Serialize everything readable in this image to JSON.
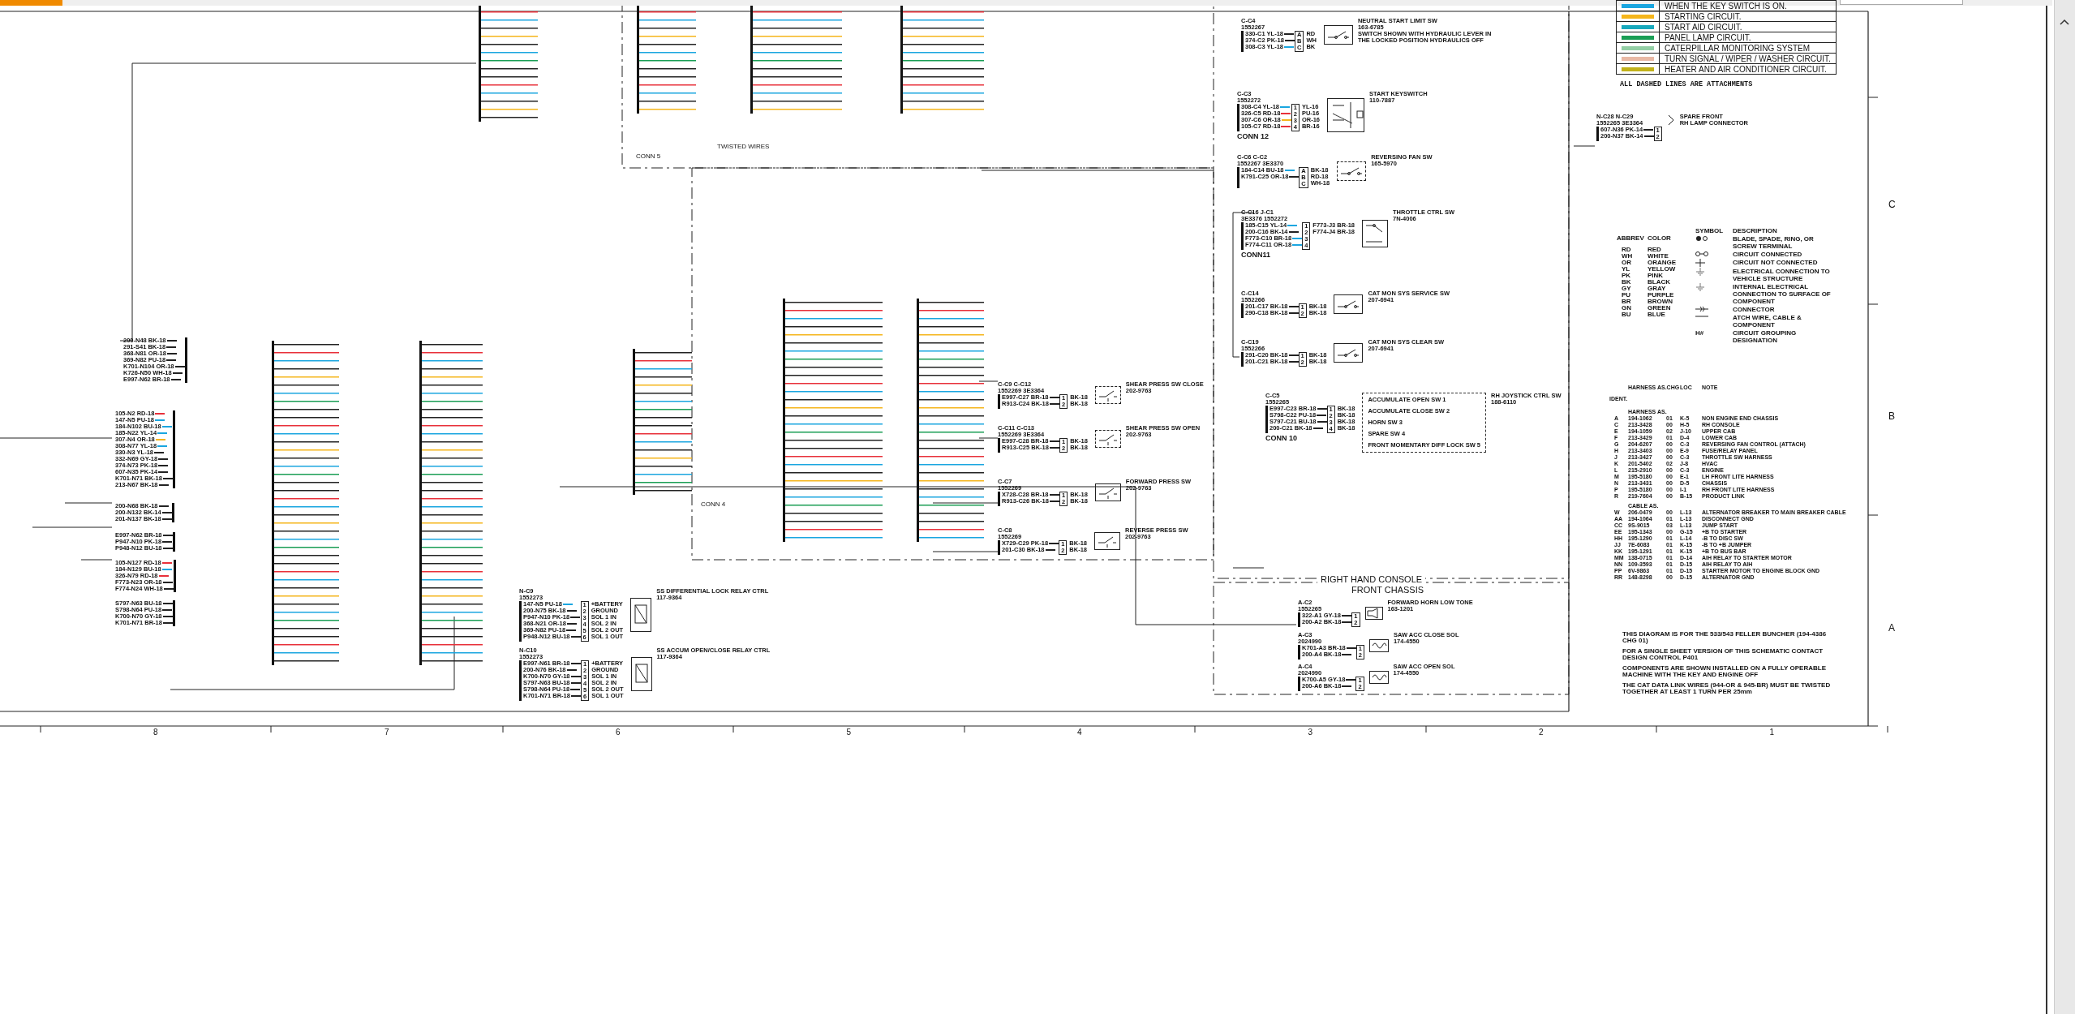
{
  "legend": {
    "rows": [
      {
        "color": "#1aa6e0",
        "label": "WHEN THE KEY SWITCH IS ON."
      },
      {
        "color": "#f5b51b",
        "label": "STARTING CIRCUIT."
      },
      {
        "color": "#17a9bd",
        "label": "START AID CIRCUIT."
      },
      {
        "color": "#1a9e55",
        "label": "PANEL LAMP CIRCUIT."
      },
      {
        "color": "#93cfa5",
        "label": "CATERPILLAR MONITORING SYSTEM"
      },
      {
        "color": "#e9b9a5",
        "label": "TURN SIGNAL / WIPER / WASHER CIRCUIT."
      },
      {
        "color": "#c2b21a",
        "label": "HEATER AND AIR CONDITIONER CIRCUIT."
      }
    ],
    "footnote": "ALL DASHED LINES ARE ATTACHMENTS"
  },
  "abbreviations": {
    "headers": [
      "ABBREV",
      "COLOR"
    ],
    "rows": [
      {
        "abbrev": "RD",
        "color_name": "RED"
      },
      {
        "abbrev": "WH",
        "color_name": "WHITE"
      },
      {
        "abbrev": "OR",
        "color_name": "ORANGE"
      },
      {
        "abbrev": "YL",
        "color_name": "YELLOW"
      },
      {
        "abbrev": "PK",
        "color_name": "PINK"
      },
      {
        "abbrev": "BK",
        "color_name": "BLACK"
      },
      {
        "abbrev": "GY",
        "color_name": "GRAY"
      },
      {
        "abbrev": "PU",
        "color_name": "PURPLE"
      },
      {
        "abbrev": "BR",
        "color_name": "BROWN"
      },
      {
        "abbrev": "GN",
        "color_name": "GREEN"
      },
      {
        "abbrev": "BU",
        "color_name": "BLUE"
      }
    ]
  },
  "symbols": {
    "headers": [
      "SYMBOL",
      "DESCRIPTION"
    ],
    "rows": [
      {
        "kind": "terminal",
        "description": "BLADE, SPADE, RING, OR SCREW TERMINAL"
      },
      {
        "kind": "connected",
        "description": "CIRCUIT CONNECTED"
      },
      {
        "kind": "not-connected",
        "description": "CIRCUIT NOT CONNECTED"
      },
      {
        "kind": "ground",
        "description": "ELECTRICAL CONNECTION TO VEHICLE STRUCTURE"
      },
      {
        "kind": "internal-ground",
        "description": "INTERNAL ELECTRICAL CONNECTION TO SURFACE OF COMPONENT"
      },
      {
        "kind": "connector",
        "description": "CONNECTOR"
      },
      {
        "kind": "attach-line",
        "description": "ATCH WIRE, CABLE & COMPONENT"
      },
      {
        "kind": "grouping",
        "symbol": "H#",
        "description": "CIRCUIT GROUPING DESIGNATION"
      }
    ]
  },
  "harness_table": {
    "headers": [
      "HARNESS AS.CHG",
      "LOC",
      "NOTE"
    ],
    "ident": "IDENT.",
    "groups": [
      {
        "title": "HARNESS AS.",
        "rows": [
          [
            "A",
            "194-1062",
            "01",
            "K-5",
            "NON ENGINE END CHASSIS"
          ],
          [
            "C",
            "213-3428",
            "00",
            "H-5",
            "RH CONSOLE"
          ],
          [
            "E",
            "194-1059",
            "02",
            "J-10",
            "UPPER CAB"
          ],
          [
            "F",
            "213-3429",
            "01",
            "D-4",
            "LOWER CAB"
          ],
          [
            "G",
            "204-6207",
            "00",
            "C-3",
            "REVERSING FAN CONTROL (ATTACH)"
          ],
          [
            "H",
            "213-3403",
            "00",
            "E-9",
            "FUSE/RELAY PANEL"
          ],
          [
            "J",
            "213-3427",
            "00",
            "C-3",
            "THROTTLE SW HARNESS"
          ],
          [
            "K",
            "201-5402",
            "02",
            "J-8",
            "HVAC"
          ],
          [
            "L",
            "215-2910",
            "00",
            "C-3",
            "ENGINE"
          ],
          [
            "M",
            "195-5180",
            "00",
            "E-1",
            "LH FRONT LITE HARNESS"
          ],
          [
            "N",
            "213-3431",
            "00",
            "D-5",
            "CHASSIS"
          ],
          [
            "P",
            "195-5180",
            "00",
            "I-1",
            "RH FRONT LITE HARNESS"
          ],
          [
            "R",
            "219-7604",
            "00",
            "B-15",
            "PRODUCT LINK"
          ]
        ]
      },
      {
        "title": "CABLE AS.",
        "rows": [
          [
            "W",
            "206-0479",
            "00",
            "L-13",
            "ALTERNATOR BREAKER TO MAIN BREAKER CABLE"
          ],
          [
            "AA",
            "194-1064",
            "01",
            "L-13",
            "DISCONNECT GND"
          ],
          [
            "CC",
            "9S-9015",
            "03",
            "L-13",
            "JUMP START"
          ],
          [
            "EE",
            "195-1343",
            "00",
            "G-15",
            "+B TO STARTER"
          ],
          [
            "HH",
            "195-1290",
            "01",
            "L-14",
            "-B TO DISC SW"
          ],
          [
            "JJ",
            "7E-6083",
            "01",
            "K-15",
            "-B TO +B JUMPER"
          ],
          [
            "KK",
            "195-1291",
            "01",
            "K-15",
            "+B TO BUS BAR"
          ],
          [
            "MM",
            "138-0715",
            "01",
            "D-14",
            "AIH RELAY TO STARTER MOTOR"
          ],
          [
            "NN",
            "109-3593",
            "01",
            "D-15",
            "AIH RELAY TO AIH"
          ],
          [
            "PP",
            "6V-9863",
            "01",
            "D-15",
            "STARTER MOTOR TO ENGINE BLOCK GND"
          ],
          [
            "RR",
            "148-8298",
            "00",
            "D-15",
            "ALTERNATOR GND"
          ]
        ]
      }
    ]
  },
  "notes": [
    "THIS DIAGRAM IS FOR THE 533/543 FELLER BUNCHER (194-4386 CHG 01)",
    "FOR A SINGLE SHEET VERSION OF THIS SCHEMATIC CONTACT DESIGN CONTROL P401",
    "COMPONENTS ARE SHOWN INSTALLED ON A FULLY OPERABLE MACHINE WITH THE KEY AND ENGINE OFF",
    "THE CAT DATA LINK WIRES (944-OR & 945-BR) MUST BE TWISTED TOGETHER AT LEAST 1 TURN PER 25mm"
  ],
  "grid": {
    "columns": [
      "8",
      "7",
      "6",
      "5",
      "4",
      "3",
      "2",
      "1"
    ],
    "rows": [
      "C",
      "B",
      "A"
    ]
  },
  "areas": [
    {
      "kind": "console",
      "title": "RIGHT HAND CONSOLE"
    },
    {
      "kind": "chassis",
      "title": "FRONT CHASSIS"
    },
    {
      "kind": "label",
      "title": "CONN 5"
    },
    {
      "kind": "label",
      "title": "CONN 4"
    },
    {
      "kind": "label",
      "title": "TWISTED WIRES"
    }
  ],
  "devices": [
    {
      "kind": "switch",
      "attachment": false,
      "title": [
        "NEUTRAL START LIMIT SW",
        "163-6785"
      ],
      "connector": [
        "C-C4",
        "1552267"
      ],
      "wires": [
        {
          "label": "330-C1 YL-18"
        },
        {
          "label": "374-C2 PK-18"
        },
        {
          "label": "308-C3 YL-18",
          "color": "#1aa6e0"
        }
      ],
      "pins": [
        "A",
        "B",
        "C"
      ],
      "outputs": [
        "RD",
        "WH",
        "BK"
      ],
      "note": "SWITCH SHOWN WITH HYDRAULIC LEVER IN THE LOCKED POSITION HYDRAULICS OFF"
    },
    {
      "kind": "keyswitch",
      "attachment": false,
      "title": [
        "START KEYSWITCH",
        "110-7887"
      ],
      "connector": [
        "C-C3",
        "1552272"
      ],
      "wires": [
        {
          "label": "308-C4 YL-18",
          "color": "#1aa6e0"
        },
        {
          "label": "326-C5 RD-18",
          "color": "#e8303a"
        },
        {
          "label": "307-C6 OR-18",
          "color": "#f5b51b"
        },
        {
          "label": "105-C7 RD-18",
          "color": "#e8303a"
        }
      ],
      "pins": [
        "1",
        "2",
        "3",
        "4"
      ],
      "outputs": [
        "YL-16",
        "PU-16",
        "OR-16",
        "BR-16"
      ],
      "footer": "CONN 12"
    },
    {
      "kind": "switch",
      "attachment": true,
      "title": [
        "REVERSING FAN SW",
        "165-5970"
      ],
      "connector": [
        "C-C6 C-C2",
        "1552267 3E3370"
      ],
      "wires": [
        {
          "label": "184-C14 BU-18",
          "color": "#1aa6e0"
        },
        {
          "label": "K791-C25 OR-18"
        }
      ],
      "pins": [
        "A",
        "B",
        "C"
      ],
      "outputs": [
        "BK-18",
        "RD-18",
        "WH-18"
      ]
    },
    {
      "kind": "throttle",
      "attachment": false,
      "title": [
        "THROTTLE CTRL SW",
        "7N-4006"
      ],
      "connector": [
        "C-C16 J-C1",
        "3E3376 1552272"
      ],
      "wires": [
        {
          "label": "185-C15 YL-14",
          "color": "#1aa6e0"
        },
        {
          "label": "200-C16 BK-14"
        },
        {
          "label": "F773-C10 BR-18",
          "color": "#1aa6e0"
        },
        {
          "label": "F774-C11 OR-18",
          "color": "#1aa6e0"
        }
      ],
      "pins": [
        "1",
        "2",
        "3",
        "4"
      ],
      "outputs": [
        "F773-J3 BR-18",
        "F774-J4 BR-18"
      ],
      "footer": "CONN11"
    },
    {
      "kind": "switch",
      "attachment": false,
      "title": [
        "CAT MON SYS SERVICE SW",
        "207-6941"
      ],
      "connector": [
        "C-C14",
        "1552266"
      ],
      "wires": [
        {
          "label": "201-C17 BK-18"
        },
        {
          "label": "290-C18 BK-18"
        }
      ],
      "pins": [
        "1",
        "2"
      ],
      "outputs": [
        "BK-18",
        "BK-18"
      ]
    },
    {
      "kind": "switch",
      "attachment": false,
      "title": [
        "CAT MON SYS CLEAR SW",
        "207-6941"
      ],
      "connector": [
        "C-C19",
        "1552266"
      ],
      "wires": [
        {
          "label": "291-C20 BK-18"
        },
        {
          "label": "201-C21 BK-18"
        }
      ],
      "pins": [
        "1",
        "2"
      ],
      "outputs": [
        "BK-18",
        "BK-18"
      ]
    },
    {
      "kind": "joystick",
      "attachment": true,
      "title": [
        "RH JOYSTICK CTRL SW",
        "188-6110"
      ],
      "connector": [
        "C-C5",
        "1552265"
      ],
      "wires": [
        {
          "label": "E997-C23 BR-18"
        },
        {
          "label": "S798-C22 PU-18"
        },
        {
          "label": "S797-C21 BU-18"
        },
        {
          "label": "200-C21 BK-18"
        }
      ],
      "pins": [
        "1",
        "2",
        "3",
        "4"
      ],
      "outputs": [
        "BK-18",
        "BK-18",
        "BK-18",
        "BK-18"
      ],
      "switches": [
        "ACCUMULATE OPEN SW 1",
        "ACCUMULATE CLOSE SW 2",
        "HORN SW 3",
        "SPARE SW 4",
        "FRONT MOMENTARY DIFF LOCK SW 5"
      ],
      "footer": "CONN 10"
    },
    {
      "kind": "pressure",
      "attachment": true,
      "title": [
        "SHEAR PRESS SW CLOSE",
        "202-9763"
      ],
      "connector": [
        "C-C9 C-C12",
        "1552269 3E3364"
      ],
      "wires": [
        {
          "label": "E997-C27 BR-18"
        },
        {
          "label": "R913-C24 BK-18"
        }
      ],
      "pins": [
        "1",
        "2"
      ],
      "outputs": [
        "BK-18",
        "BK-18"
      ]
    },
    {
      "kind": "pressure",
      "attachment": true,
      "title": [
        "SHEAR PRESS SW OPEN",
        "202-9763"
      ],
      "connector": [
        "C-C11 C-C13",
        "1552269 3E3364"
      ],
      "wires": [
        {
          "label": "E997-C28 BR-18"
        },
        {
          "label": "R913-C25 BK-18"
        }
      ],
      "pins": [
        "1",
        "2"
      ],
      "outputs": [
        "BK-18",
        "BK-18"
      ]
    },
    {
      "kind": "pressure",
      "attachment": false,
      "title": [
        "FORWARD PRESS SW",
        "202-9763"
      ],
      "connector": [
        "C-C7",
        "1552269"
      ],
      "wires": [
        {
          "label": "X728-C28 BR-18"
        },
        {
          "label": "R913-C26 BK-18"
        }
      ],
      "pins": [
        "1",
        "2"
      ],
      "outputs": [
        "BK-18",
        "BK-18"
      ]
    },
    {
      "kind": "pressure",
      "attachment": false,
      "title": [
        "REVERSE PRESS SW",
        "202-9763"
      ],
      "connector": [
        "C-C8",
        "1552269"
      ],
      "wires": [
        {
          "label": "X729-C29 PK-18"
        },
        {
          "label": "201-C30 BK-18"
        }
      ],
      "pins": [
        "1",
        "2"
      ],
      "outputs": [
        "BK-18",
        "BK-18"
      ]
    },
    {
      "kind": "horn",
      "title": [
        "FORWARD HORN LOW TONE",
        "163-1201"
      ],
      "connector": [
        "A-C2",
        "1552265"
      ],
      "wires": [
        {
          "label": "322-A1 GY-18"
        },
        {
          "label": "200-A2 BK-18"
        }
      ],
      "pins": [
        "1",
        "2"
      ]
    },
    {
      "kind": "solenoid",
      "title": [
        "SAW ACC CLOSE SOL",
        "174-4550"
      ],
      "connector": [
        "A-C3",
        "2024990"
      ],
      "wires": [
        {
          "label": "K701-A3 BR-18"
        },
        {
          "label": "200-A4 BK-18"
        }
      ],
      "pins": [
        "1",
        "2"
      ]
    },
    {
      "kind": "solenoid",
      "title": [
        "SAW ACC OPEN SOL",
        "174-4550"
      ],
      "connector": [
        "A-C4",
        "2024990"
      ],
      "wires": [
        {
          "label": "K700-A5 GY-18"
        },
        {
          "label": "200-A6 BK-18"
        }
      ],
      "pins": [
        "1",
        "2"
      ]
    },
    {
      "kind": "lamp",
      "title": [
        "SPARE FRONT",
        "RH LAMP CONNECTOR"
      ],
      "connector": [
        "N-C28 N-C29",
        "1552265 3E3364"
      ],
      "wires": [
        {
          "label": "607-N36 PK-14"
        },
        {
          "label": "200-N37 BK-14"
        }
      ],
      "pins": [
        "1",
        "2"
      ]
    },
    {
      "kind": "relay",
      "title": [
        "SS DIFFERENTIAL LOCK RELAY CTRL",
        "117-9364"
      ],
      "connector": [
        "N-C9",
        "1552273"
      ],
      "wires": [
        {
          "label": "147-N5 PU-18",
          "color": "#1aa6e0"
        },
        {
          "label": "200-N75 BK-18"
        },
        {
          "label": "P947-N10 PK-18"
        },
        {
          "label": "368-N21 OR-18"
        },
        {
          "label": "369-N82 PU-18"
        },
        {
          "label": "P948-N12 BU-18"
        }
      ],
      "pins": [
        "1",
        "2",
        "3",
        "4",
        "5",
        "6"
      ],
      "outputs": [
        "+BATTERY",
        "GROUND",
        "SOL 1 IN",
        "SOL 2 IN",
        "SOL 2 OUT",
        "SOL 1 OUT"
      ]
    },
    {
      "kind": "relay",
      "title": [
        "SS ACCUM OPEN/CLOSE RELAY CTRL",
        "117-9364"
      ],
      "connector": [
        "N-C10",
        "1552273"
      ],
      "wires": [
        {
          "label": "E997-N61 BR-18"
        },
        {
          "label": "200-N76 BK-18"
        },
        {
          "label": "K700-N70 GY-18"
        },
        {
          "label": "S797-N63 BU-18"
        },
        {
          "label": "S798-N64 PU-18"
        },
        {
          "label": "K701-N71 BR-18"
        }
      ],
      "pins": [
        "1",
        "2",
        "3",
        "4",
        "5",
        "6"
      ],
      "outputs": [
        "+BATTERY",
        "GROUND",
        "SOL 1 IN",
        "SOL 2 IN",
        "SOL 2 OUT",
        "SOL 1 OUT"
      ]
    }
  ],
  "bundles": [
    {
      "wires": [
        {
          "label": "200-N48 BK-18"
        },
        {
          "label": "291-S41 BK-18"
        },
        {
          "label": "368-N81 OR-18"
        },
        {
          "label": "369-N82 PU-18"
        },
        {
          "label": "K701-N104 OR-18"
        },
        {
          "label": "K726-N50 WH-18"
        },
        {
          "label": "E997-N62 BR-18"
        }
      ]
    },
    {
      "wires": [
        {
          "label": "105-N2 RD-18",
          "color": "#e8303a"
        },
        {
          "label": "147-N5 PU-18",
          "color": "#1aa6e0"
        },
        {
          "label": "184-N102 BU-18",
          "color": "#1aa6e0"
        },
        {
          "label": "185-N22 YL-14",
          "color": "#1aa6e0"
        },
        {
          "label": "307-N4 OR-18",
          "color": "#f5b51b"
        },
        {
          "label": "308-N77 YL-18",
          "color": "#1aa6e0"
        },
        {
          "label": "330-N3 YL-18"
        },
        {
          "label": "332-N69 GY-18"
        },
        {
          "label": "374-N73 PK-18"
        },
        {
          "label": "607-N35 PK-14"
        },
        {
          "label": "K701-N71 BK-18"
        },
        {
          "label": "213-N67 BK-18"
        }
      ]
    },
    {
      "wires": [
        {
          "label": "200-N68 BK-18"
        },
        {
          "label": "200-N132 BK-14"
        },
        {
          "label": "201-N137 BK-18"
        }
      ]
    },
    {
      "wires": [
        {
          "label": "E997-N62 BR-18"
        },
        {
          "label": "P947-N10 PK-18"
        },
        {
          "label": "P948-N12 BU-18"
        }
      ]
    },
    {
      "wires": [
        {
          "label": "105-N127 RD-18",
          "color": "#e8303a"
        },
        {
          "label": "184-N129 BU-18",
          "color": "#1aa6e0"
        },
        {
          "label": "326-N79 RD-18",
          "color": "#e8303a"
        },
        {
          "label": "F773-N23 OR-18"
        },
        {
          "label": "F774-N24 WH-18"
        }
      ]
    },
    {
      "wires": [
        {
          "label": "S797-N63 BU-18"
        },
        {
          "label": "S798-N64 PU-18"
        },
        {
          "label": "K700-N70 GY-18"
        },
        {
          "label": "K701-N71 BR-18"
        }
      ]
    }
  ]
}
